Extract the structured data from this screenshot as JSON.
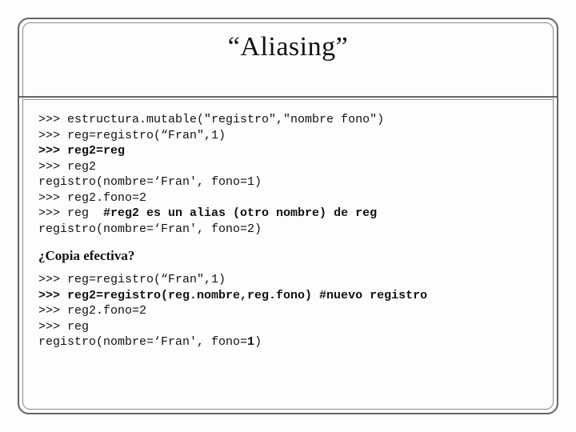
{
  "title": "“Aliasing”",
  "block1": {
    "l1": ">>> estructura.mutable(\"registro\",\"nombre fono\")",
    "l2": ">>> reg=registro(“Fran\",1)",
    "l3": ">>> reg2=reg",
    "l4": ">>> reg2",
    "l5": "registro(nombre=‘Fran', fono=1)",
    "l6": ">>> reg2.fono=2",
    "l7a": ">>> reg  ",
    "l7b": "#reg2 es un alias (otro nombre) de reg",
    "l8": "registro(nombre=‘Fran', fono=2)"
  },
  "subhead": "¿Copia efectiva?",
  "block2": {
    "l1": ">>> reg=registro(“Fran\",1)",
    "l2": ">>> reg2=registro(reg.nombre,reg.fono) #nuevo registro",
    "l3": ">>> reg2.fono=2",
    "l4": ">>> reg",
    "l5a": "registro(nombre=‘Fran', fono=",
    "l5b": "1",
    "l5c": ")"
  }
}
